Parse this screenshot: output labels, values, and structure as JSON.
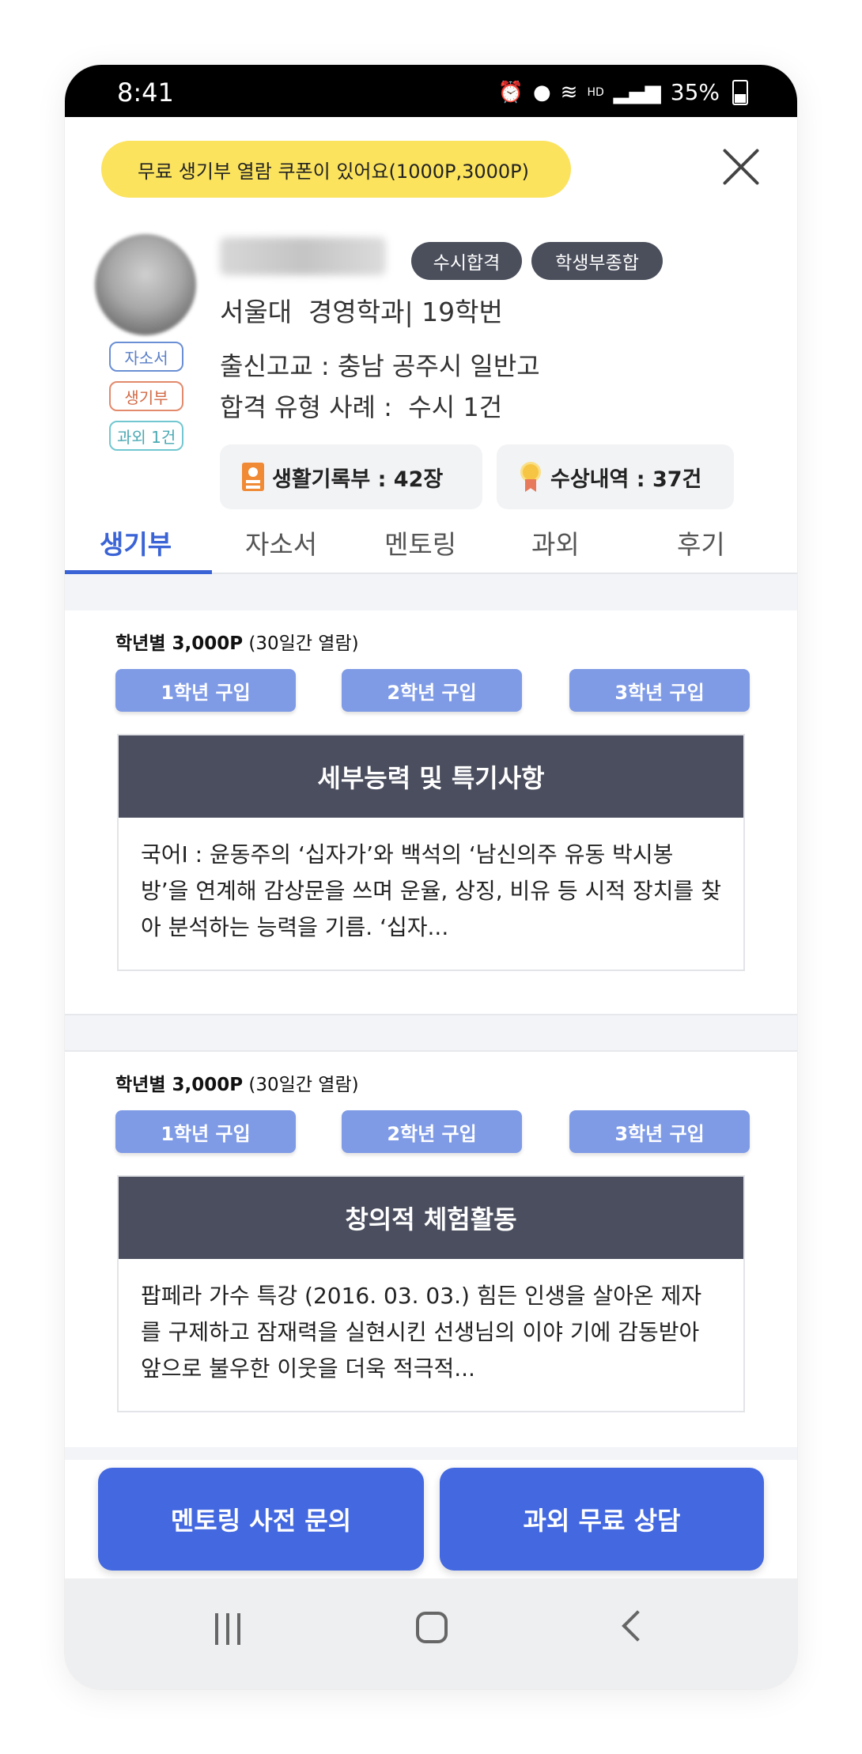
{
  "status_bar": {
    "time": "8:41",
    "network": "HD",
    "battery": "35%"
  },
  "coupon_banner": "무료 생기부 열람 쿠폰이 있어요(1000P,3000P)",
  "profile": {
    "tags": [
      "자소서",
      "생기부",
      "과외 1건"
    ],
    "badges": [
      "수시합격",
      "학생부종합"
    ],
    "school_line": "서울대  경영학과| 19학번",
    "origin_line": "출신고교 : 충남 공주시 일반고",
    "case_line": "합격 유형 사례 :  수시 1건",
    "stats": {
      "record_label": "생활기록부 : 42장",
      "award_label": "수상내역 : 37건"
    }
  },
  "tabs": [
    {
      "label": "생기부",
      "active": true
    },
    {
      "label": "자소서",
      "active": false
    },
    {
      "label": "멘토링",
      "active": false
    },
    {
      "label": "과외",
      "active": false
    },
    {
      "label": "후기",
      "active": false
    }
  ],
  "sections": [
    {
      "price_bold": "학년별 3,000P",
      "price_rest": " (30일간 열람)",
      "buy_buttons": [
        "1학년 구입",
        "2학년 구입",
        "3학년 구입"
      ],
      "card_title": "세부능력 및 특기사항",
      "card_text": "국어I : 윤동주의 ‘십자가’와 백석의 ‘남신의주 유동 박시봉 방’을 연계해 감상문을 쓰며 운율, 상징, 비유 등 시적 장치를 찾아 분석하는 능력을 기름. ‘십자..."
    },
    {
      "price_bold": "학년별 3,000P",
      "price_rest": " (30일간 열람)",
      "buy_buttons": [
        "1학년 구입",
        "2학년 구입",
        "3학년 구입"
      ],
      "card_title": "창의적 체험활동",
      "card_text": "팝페라 가수 특강 (2016. 03. 03.) 힘든 인생을 살아온 제자를 구제하고 잠재력을 실현시킨 선생님의 이야 기에 감동받아 앞으로 불우한 이웃을 더욱 적극적..."
    }
  ],
  "cta": {
    "left": "멘토링 사전 문의",
    "right": "과외 무료 상담"
  },
  "colors": {
    "accent": "#3a63d6",
    "coupon_bg": "#fbe35e",
    "buy_button": "#7f9be6",
    "card_header": "#4a4e5e",
    "cta": "#4368e0"
  }
}
